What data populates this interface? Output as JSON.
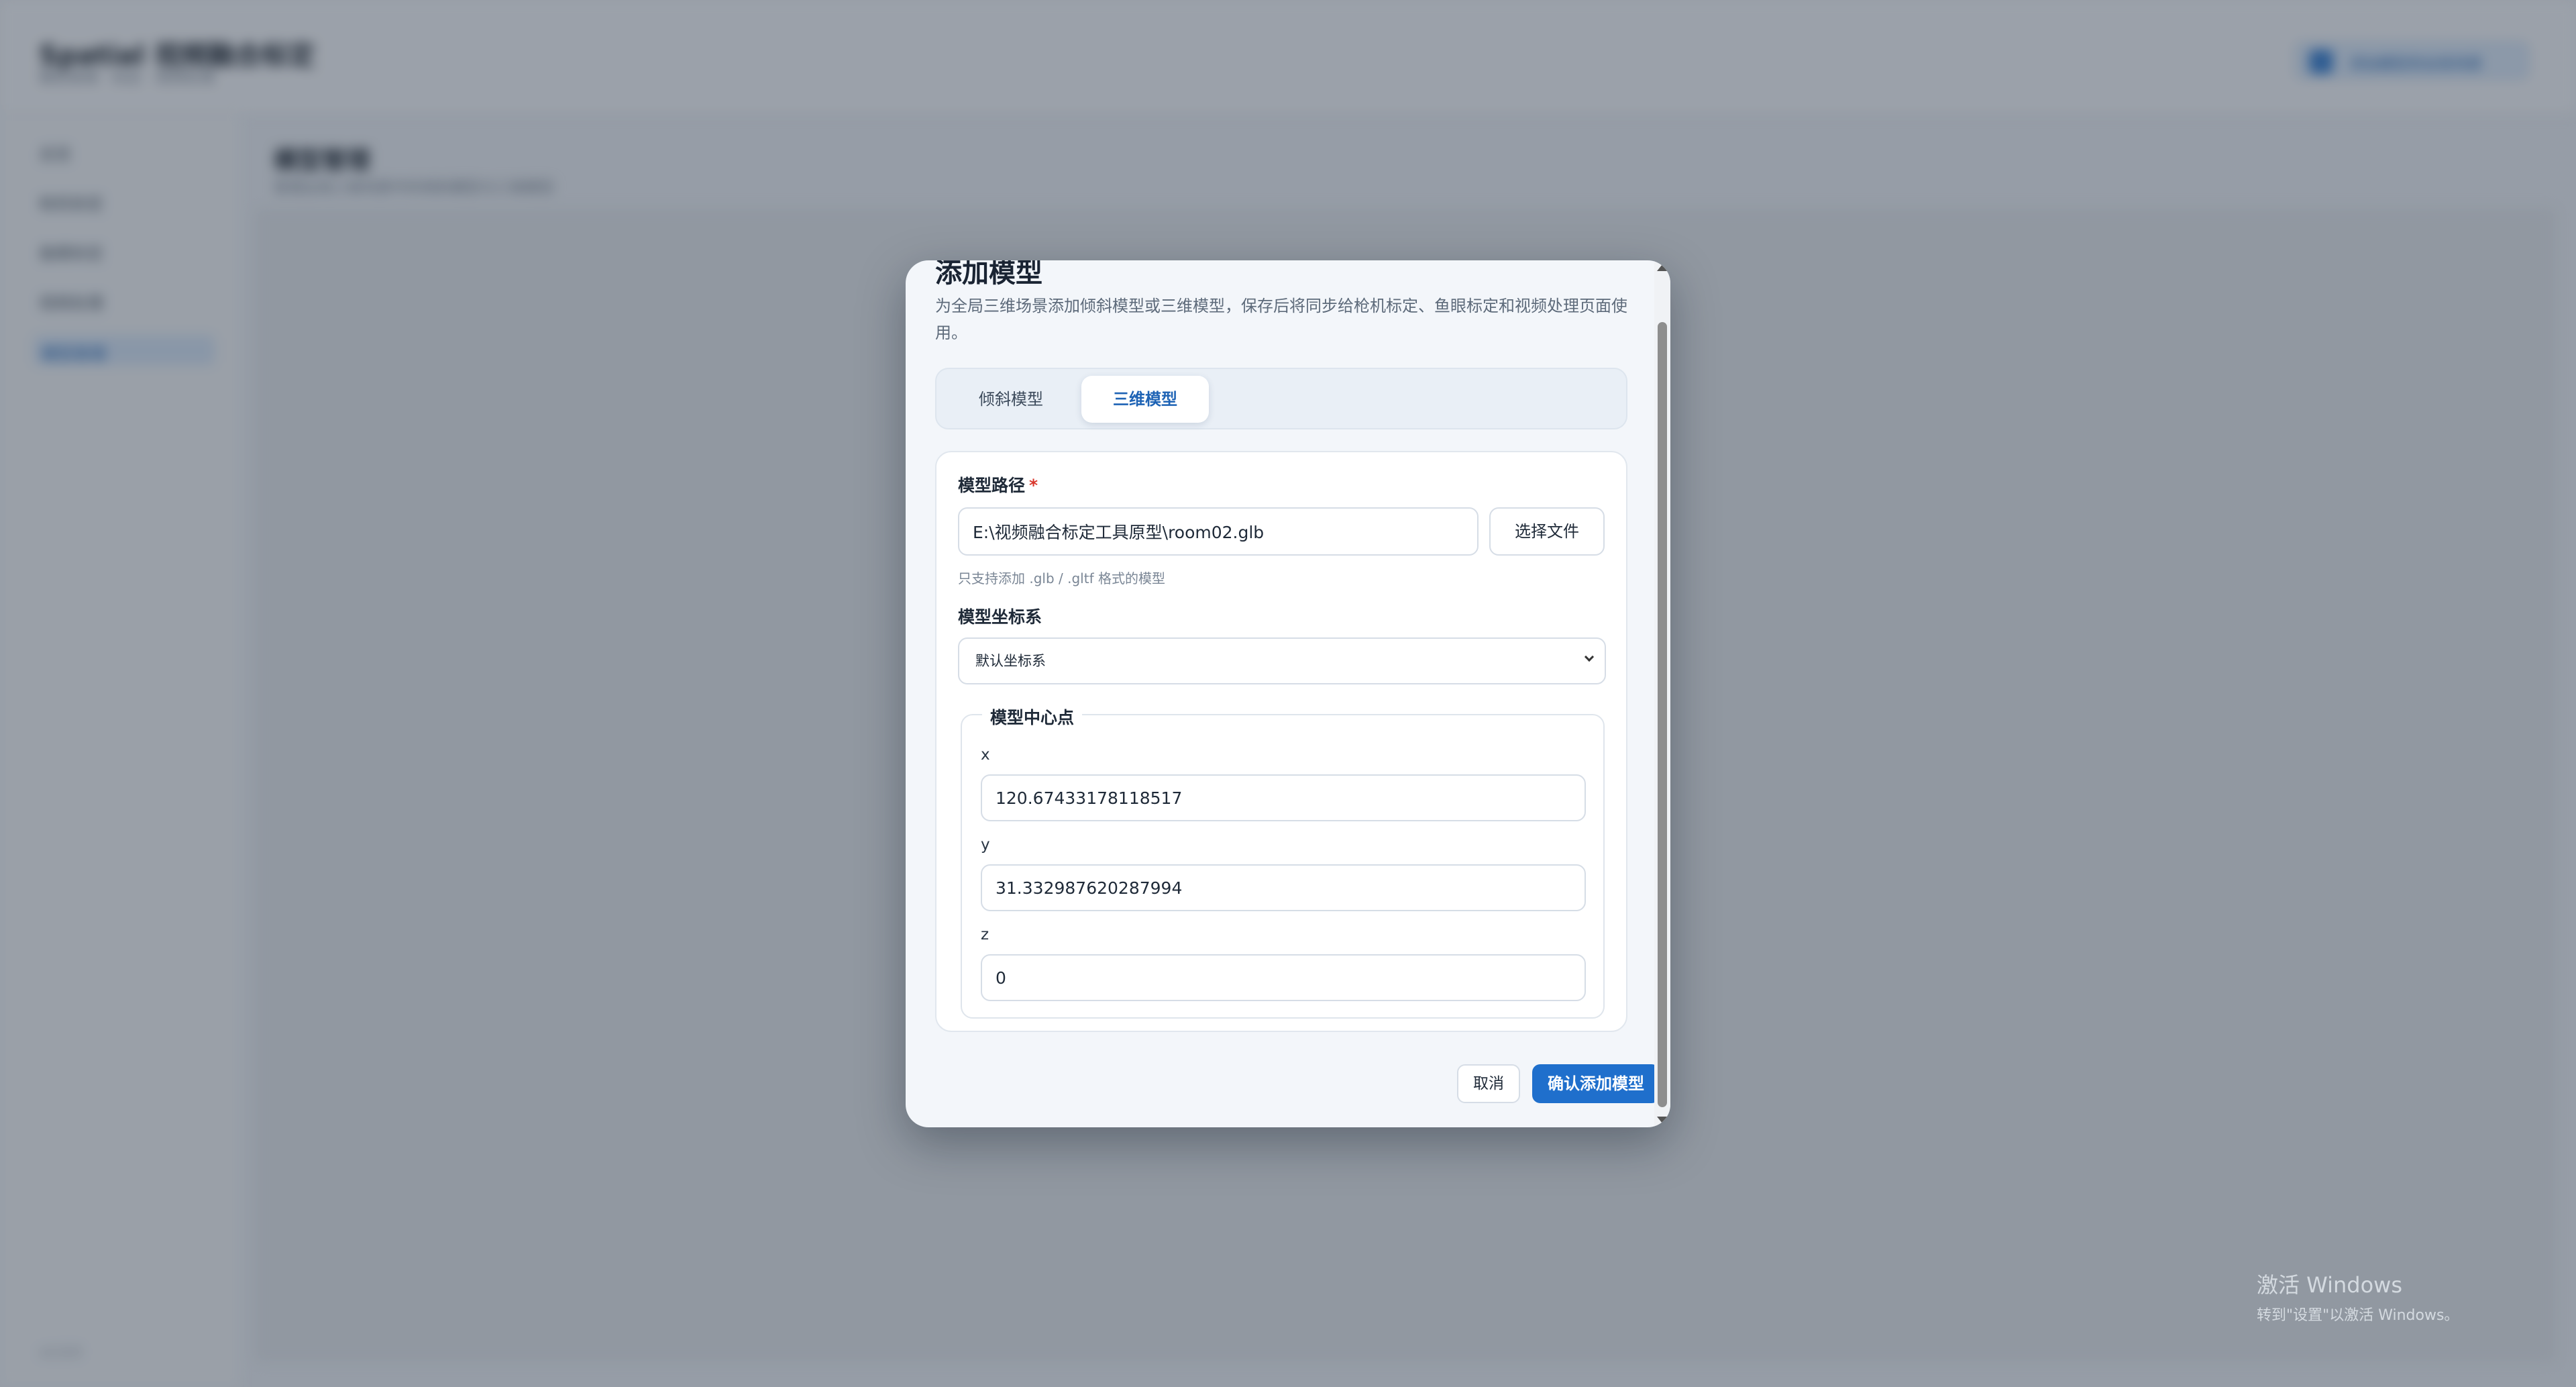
{
  "background": {
    "app_title": "Spatial 视频融合标定",
    "app_subtitle": "模型管理 · 标定 · 视频处理",
    "header_button": "添加模型到全局场景",
    "sidebar_items": [
      "总览",
      "枪机标定",
      "鱼眼标定",
      "视频处理",
      "模型管理"
    ],
    "sidebar_footer": "v1.0.0",
    "main_title": "模型管理",
    "main_desc": "管理全局三维场景中的倾斜模型与三维模型",
    "watermark_line1": "激活 Windows",
    "watermark_line2": "转到\"设置\"以激活 Windows。"
  },
  "modal": {
    "title": "添加模型",
    "description": "为全局三维场景添加倾斜模型或三维模型，保存后将同步给枪机标定、鱼眼标定和视频处理页面使用。",
    "tabs": [
      {
        "label": "倾斜模型",
        "active": false
      },
      {
        "label": "三维模型",
        "active": true
      }
    ],
    "model_path": {
      "label": "模型路径",
      "required_mark": "*",
      "value": "E:\\视频融合标定工具原型\\room02.glb",
      "choose_file_button": "选择文件",
      "hint": "只支持添加 .glb / .gltf 格式的模型"
    },
    "coordinate_system": {
      "label": "模型坐标系",
      "selected": "默认坐标系"
    },
    "center_point": {
      "legend": "模型中心点",
      "x_label": "x",
      "x_value": "120.67433178118517",
      "y_label": "y",
      "y_value": "31.332987620287994",
      "z_label": "z",
      "z_value": "0"
    },
    "cancel_button": "取消",
    "confirm_button": "确认添加模型"
  },
  "colors": {
    "primary": "#1f6fcc",
    "required": "#d9362b",
    "overlay": "rgba(28,38,52,0.40)"
  }
}
